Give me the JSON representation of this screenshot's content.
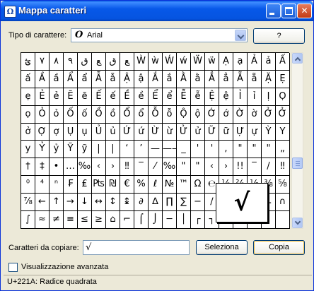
{
  "window": {
    "title": "Mappa caratteri"
  },
  "font": {
    "label": "Tipo di carattere:",
    "value": "Arial",
    "icon": "O"
  },
  "help_button": "?",
  "grid": {
    "rows": [
      [
        "ؿ",
        "٧",
        "٨",
        "٩",
        "ﻕ",
        "ﻊ",
        "ﻕ",
        "ﻊ",
        "Ẁ",
        "ẁ",
        "Ẃ",
        "ẃ",
        "Ẅ",
        "ẅ",
        "Ạ",
        "ạ",
        "Ả",
        "ả",
        "Ấ"
      ],
      [
        "ấ",
        "Ầ",
        "ầ",
        "Ẩ",
        "ẩ",
        "Ẫ",
        "ẫ",
        "Ậ",
        "ậ",
        "Ắ",
        "ắ",
        "Ằ",
        "ằ",
        "Ẳ",
        "ẳ",
        "Ẵ",
        "ẵ",
        "Ặ",
        "Ẹ"
      ],
      [
        "ẹ",
        "Ẻ",
        "ẻ",
        "Ẽ",
        "ẽ",
        "Ế",
        "ế",
        "Ề",
        "ề",
        "Ể",
        "ể",
        "Ễ",
        "ễ",
        "Ệ",
        "ệ",
        "Ỉ",
        "ỉ",
        "Ị",
        "Ọ"
      ],
      [
        "ọ",
        "Ỏ",
        "ỏ",
        "Ố",
        "ố",
        "Ồ",
        "ồ",
        "Ổ",
        "ổ",
        "Ỗ",
        "ỗ",
        "Ộ",
        "ộ",
        "Ớ",
        "ớ",
        "Ờ",
        "ờ",
        "Ở",
        "Ở"
      ],
      [
        "ở",
        "Ợ",
        "ợ",
        "Ụ",
        "ụ",
        "Ủ",
        "ủ",
        "Ứ",
        "ứ",
        "Ừ",
        "ừ",
        "Ử",
        "ử",
        "Ữ",
        "ữ",
        "Ự",
        "ự",
        "Ỳ",
        "Y"
      ],
      [
        "y",
        "Ỷ",
        "ỷ",
        "Ỹ",
        "ỹ",
        "|",
        "|",
        "‘",
        "’",
        "—",
        "——",
        "_",
        "'",
        "'",
        ",",
        "\"",
        "\"",
        "\"",
        "„"
      ],
      [
        "†",
        "‡",
        "•",
        "…",
        "‰",
        "‹",
        "›",
        "‼",
        "‾",
        "⁄",
        "‰",
        "\"",
        "\"",
        "‹",
        "›",
        "!!",
        "‾",
        "/",
        "‼"
      ],
      [
        "⁰",
        "⁴",
        "ⁿ",
        "₣",
        "₤",
        "₧",
        "₪",
        "€",
        "%",
        "ℓ",
        "№",
        "™",
        "Ω",
        "℮",
        "⅓",
        "⅔",
        "⅛",
        "⅜",
        "⅝"
      ],
      [
        "⅞",
        "←",
        "↑",
        "→",
        "↓",
        "↔",
        "↕",
        "↨",
        "∂",
        "∆",
        "∏",
        "∑",
        "−",
        "∕",
        "∙",
        "√",
        "∞",
        "∟",
        "∩"
      ],
      [
        "∫",
        "≈",
        "≠",
        "≡",
        "≤",
        "≥",
        "⌂",
        "⌐",
        "⌠",
        "⌡",
        "─",
        "│",
        "┌",
        "┐",
        "",
        "",
        "",
        "",
        ""
      ]
    ]
  },
  "magnified_char": "√",
  "copy": {
    "label": "Caratteri da copiare:",
    "value": "√"
  },
  "buttons": {
    "select": "Seleziona",
    "copy": "Copia"
  },
  "advanced": {
    "label": "Visualizzazione avanzata",
    "checked": false
  },
  "status": "U+221A: Radice quadrata"
}
